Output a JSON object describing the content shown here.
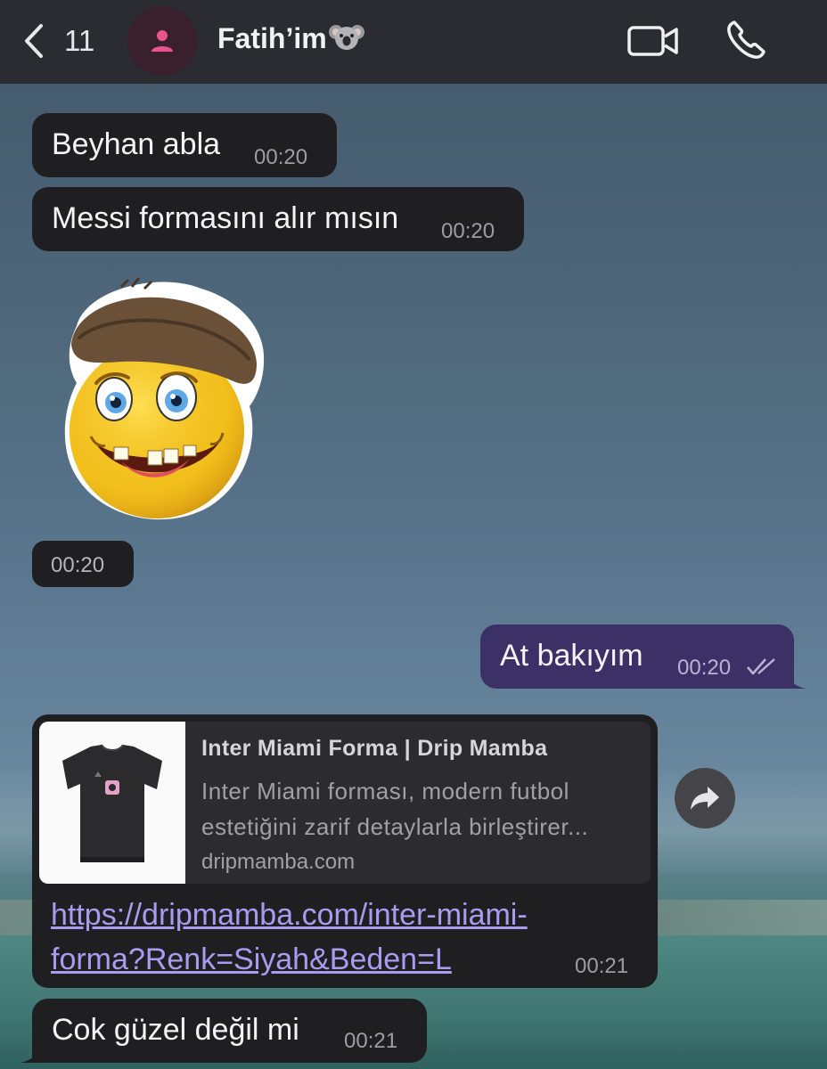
{
  "header": {
    "back_count": "11",
    "contact_name": "Fatih’im",
    "contact_emoji": "koala-emoji"
  },
  "messages": [
    {
      "direction": "in",
      "text": "Beyhan abla",
      "time": "00:20"
    },
    {
      "direction": "in",
      "text": "Messi formasını alır mısın",
      "time": "00:20"
    },
    {
      "direction": "in",
      "type": "sticker",
      "sticker": "smiley-with-cap-sticker",
      "time": "00:20"
    },
    {
      "direction": "out",
      "text": "At bakıyım",
      "time": "00:20",
      "status": "read-double-check"
    },
    {
      "direction": "in",
      "type": "link",
      "preview": {
        "title": "Inter Miami Forma | Drip Mamba",
        "description_line1": "Inter Miami forması, modern futbol",
        "description_line2": "estetiğini zarif detaylarla birleştirer...",
        "domain": "dripmamba.com",
        "image": "black-jersey-thumbnail"
      },
      "link_line1": "https://dripmamba.com/inter-miami-",
      "link_line2": "forma?Renk=Siyah&Beden=L",
      "time": "00:21"
    },
    {
      "direction": "in",
      "text": "Cok güzel değil mi",
      "time": "00:21"
    }
  ],
  "colors": {
    "incoming_bubble": "#1f1f22",
    "outgoing_bubble": "#3b3166",
    "link": "#a99cf0",
    "avatar_bg": "#3a1f2c",
    "avatar_icon": "#e8548e"
  }
}
